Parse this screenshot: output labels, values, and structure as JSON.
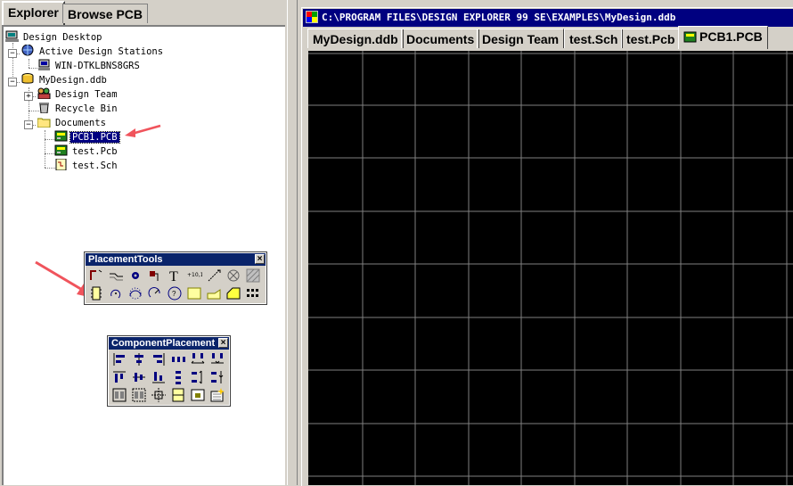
{
  "explorer": {
    "tabs": [
      "Explorer",
      "Browse PCB"
    ],
    "tree": {
      "root": "Design Desktop",
      "stations": "Active Design Stations",
      "station_name": "WIN-DTKLBNS8GRS",
      "database": "MyDesign.ddb",
      "design_team": "Design Team",
      "recycle_bin": "Recycle Bin",
      "documents": "Documents",
      "files": [
        "PCB1.PCB",
        "test.Pcb",
        "test.Sch"
      ]
    }
  },
  "document": {
    "title": "C:\\PROGRAM FILES\\DESIGN EXPLORER 99 SE\\EXAMPLES\\MyDesign.ddb",
    "tabs": [
      "MyDesign.ddb",
      "Documents",
      "Design Team",
      "test.Sch",
      "test.Pcb",
      "PCB1.PCB"
    ],
    "active_tab": "PCB1.PCB"
  },
  "placement_tools": {
    "title": "PlacementTools",
    "close": "×",
    "icons": [
      "track-icon",
      "interactive-route-icon",
      "via-icon",
      "pad-icon",
      "string-icon",
      "coordinate-icon",
      "dimension-icon",
      "coordinate-pad-icon",
      "fill-hatch-icon",
      "component-icon",
      "arc-center-icon",
      "arc-edge-icon",
      "arc-any-icon",
      "full-circle-icon",
      "fill-icon",
      "polygon-icon",
      "split-plane-icon",
      "array-paste-icon"
    ]
  },
  "component_placement": {
    "title": "ComponentPlacement",
    "close": "×",
    "icons": [
      "align-left-icon",
      "align-horizontal-center-icon",
      "align-right-icon",
      "make-horizontal-spacing-equal-icon",
      "increase-horizontal-spacing-icon",
      "decrease-horizontal-spacing-icon",
      "align-top-icon",
      "align-vertical-center-icon",
      "align-bottom-icon",
      "make-vertical-spacing-equal-icon",
      "increase-vertical-spacing-icon",
      "decrease-vertical-spacing-icon",
      "arrange-in-room-icon",
      "arrange-in-rectangle-icon",
      "arrange-outside-board-icon",
      "move-to-grid-icon",
      "move-to-room-icon",
      "auto-place-icon"
    ]
  },
  "colors": {
    "canvas": "#000000",
    "grid": "#808080",
    "title_bar": "#000080",
    "selection": "#000080",
    "annotation_arrow": "#f0545c"
  }
}
